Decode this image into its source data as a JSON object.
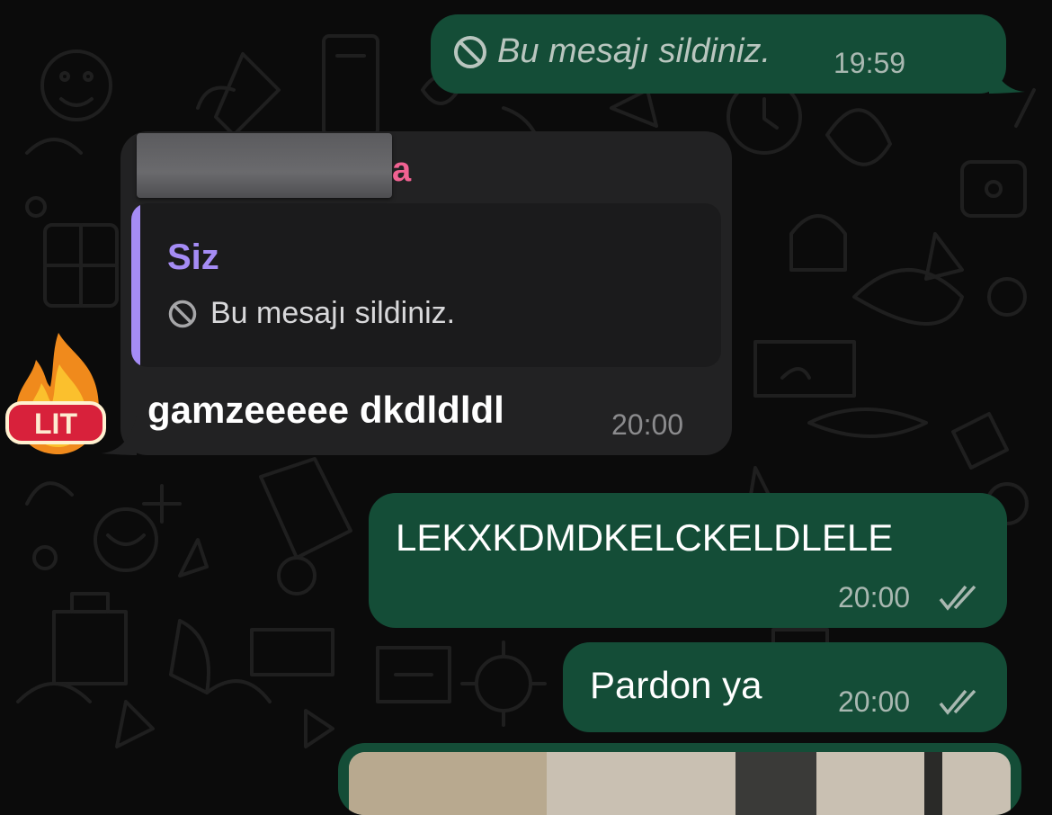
{
  "messages": [
    {
      "id": "m1",
      "direction": "outgoing",
      "deleted": true,
      "text": "Bu mesajı sildiniz.",
      "time": "19:59"
    },
    {
      "id": "m2",
      "direction": "incoming",
      "sender_suffix": "a",
      "reply": {
        "author": "Siz",
        "text": "Bu mesajı sildiniz."
      },
      "text": "gamzeeeee dkdldldl",
      "time": "20:00",
      "sticker": {
        "label": "LIT",
        "icon": "fire-lit-sticker"
      }
    },
    {
      "id": "m3",
      "direction": "outgoing",
      "text": "LEKXKDMDKELCKELDLELE",
      "time": "20:00",
      "status": "read-double-check"
    },
    {
      "id": "m4",
      "direction": "outgoing",
      "text": "Pardon ya",
      "time": "20:00",
      "status": "read-double-check"
    }
  ],
  "colors": {
    "background": "#0b0b0b",
    "outgoing_bubble": "#144d37",
    "incoming_bubble": "#222223",
    "quote_accent": "#a58cf5",
    "sender_name": "#f06292"
  }
}
